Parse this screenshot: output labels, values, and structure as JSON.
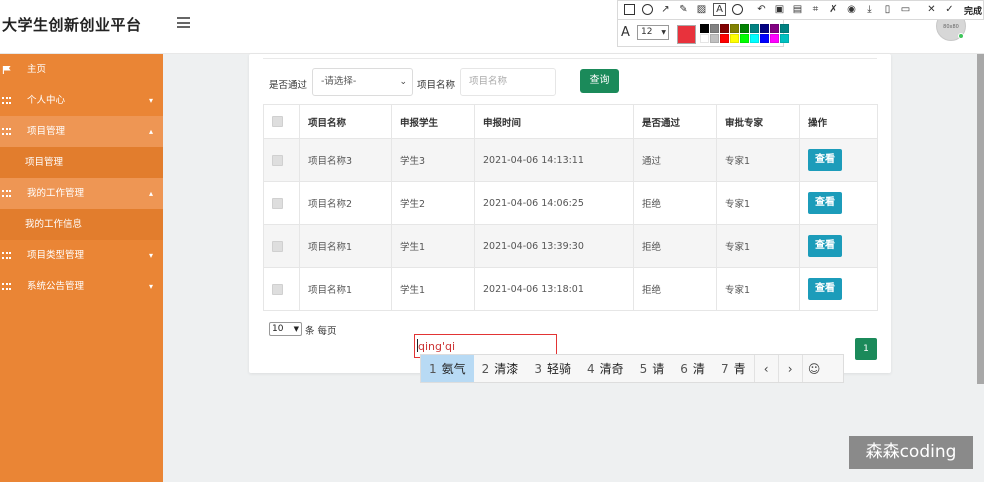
{
  "header": {
    "brand": "大学生创新创业平台",
    "avatar_text": "80x80"
  },
  "sidebar": {
    "items": [
      {
        "label": "主页",
        "icon": "flag-icon"
      },
      {
        "label": "个人中心",
        "icon": "grid-icon",
        "caret": "▾"
      },
      {
        "label": "项目管理",
        "icon": "grid-icon",
        "caret": "▴",
        "sub": "项目管理"
      },
      {
        "label": "我的工作管理",
        "icon": "grid-icon",
        "caret": "▴",
        "sub": "我的工作信息"
      },
      {
        "label": "项目类型管理",
        "icon": "grid-icon",
        "caret": "▾"
      },
      {
        "label": "系统公告管理",
        "icon": "grid-icon",
        "caret": "▾"
      }
    ]
  },
  "filters": {
    "passed_label": "是否通过",
    "passed_value": "-请选择-",
    "name_label": "项目名称",
    "name_placeholder": "项目名称",
    "query_button": "查询"
  },
  "table": {
    "headers": [
      "项目名称",
      "申报学生",
      "申报时间",
      "是否通过",
      "审批专家",
      "操作"
    ],
    "rows": [
      {
        "name": "项目名称3",
        "student": "学生3",
        "time": "2021-04-06 14:13:11",
        "status": "通过",
        "expert": "专家1",
        "action": "查看"
      },
      {
        "name": "项目名称2",
        "student": "学生2",
        "time": "2021-04-06 14:06:25",
        "status": "拒绝",
        "expert": "专家1",
        "action": "查看"
      },
      {
        "name": "项目名称1",
        "student": "学生1",
        "time": "2021-04-06 13:39:30",
        "status": "拒绝",
        "expert": "专家1",
        "action": "查看"
      },
      {
        "name": "项目名称1",
        "student": "学生1",
        "time": "2021-04-06 13:18:01",
        "status": "拒绝",
        "expert": "专家1",
        "action": "查看"
      }
    ]
  },
  "pagination": {
    "page_size": "10",
    "per_page_label": "条 每页",
    "current_page": "1"
  },
  "ime": {
    "composition": "qing'qi",
    "candidates": [
      {
        "n": "1",
        "text": "氨气"
      },
      {
        "n": "2",
        "text": "清漆"
      },
      {
        "n": "3",
        "text": "轻骑"
      },
      {
        "n": "4",
        "text": "清奇"
      },
      {
        "n": "5",
        "text": "请"
      },
      {
        "n": "6",
        "text": "清"
      },
      {
        "n": "7",
        "text": "青"
      }
    ],
    "prev": "‹",
    "next": "›",
    "emoji": "☺"
  },
  "screenshot_toolbar": {
    "done_label": "完成",
    "font_size": "12",
    "current_color": "#e8323c",
    "palette": [
      "#000000",
      "#808080",
      "#800000",
      "#808000",
      "#008000",
      "#008080",
      "#000080",
      "#800080",
      "#008080",
      "#ffffff",
      "#c0c0c0",
      "#ff0000",
      "#ffff00",
      "#00ff00",
      "#00ffff",
      "#0000ff",
      "#ff00ff",
      "#00c0c0"
    ]
  },
  "watermark": "森森coding",
  "colors": {
    "sidebar": "#ea8535",
    "query_button": "#1b8a5a",
    "view_button": "#1c9cba"
  }
}
